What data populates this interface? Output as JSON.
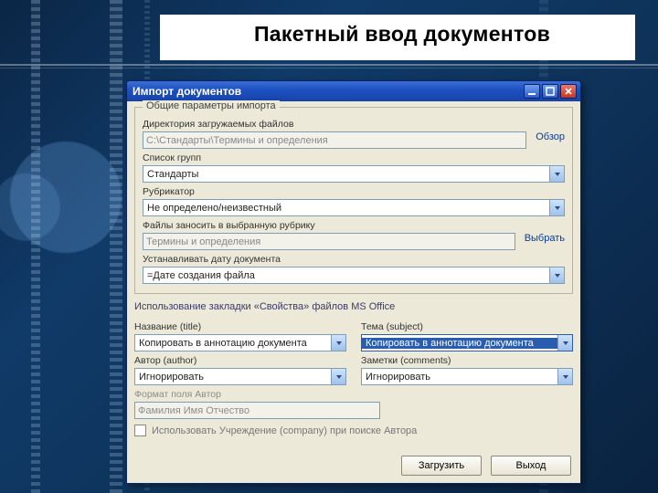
{
  "slide": {
    "title": "Пакетный ввод документов"
  },
  "window": {
    "title": "Импорт документов",
    "close": "×"
  },
  "group1": {
    "legend": "Общие параметры импорта",
    "dir_label": "Директория загружаемых файлов",
    "dir_value": "C:\\Стандарты\\Термины и определения",
    "browse": "Обзор",
    "groups_label": "Список групп",
    "groups_value": "Стандарты",
    "rubricator_label": "Рубрикатор",
    "rubricator_value": "Не определено/неизвестный",
    "file_rubric_label": "Файлы заносить в выбранную рубрику",
    "file_rubric_value": "Термины и определения",
    "choose": "Выбрать",
    "date_label": "Устанавливать дату документа",
    "date_value": "=Дате создания файла"
  },
  "office": {
    "section": "Использование закладки «Свойства» файлов MS Office",
    "title_label": "Название (title)",
    "title_value": "Копировать в аннотацию документа",
    "subject_label": "Тема (subject)",
    "subject_value": "Копировать в аннотацию документа",
    "author_label": "Автор (author)",
    "author_value": "Игнорировать",
    "comments_label": "Заметки (comments)",
    "comments_value": "Игнорировать",
    "author_format_label": "Формат поля Автор",
    "author_format_value": "Фамилия Имя Отчество",
    "company_checkbox": "Использовать Учреждение (company) при поиске Автора"
  },
  "buttons": {
    "load": "Загрузить",
    "exit": "Выход"
  }
}
